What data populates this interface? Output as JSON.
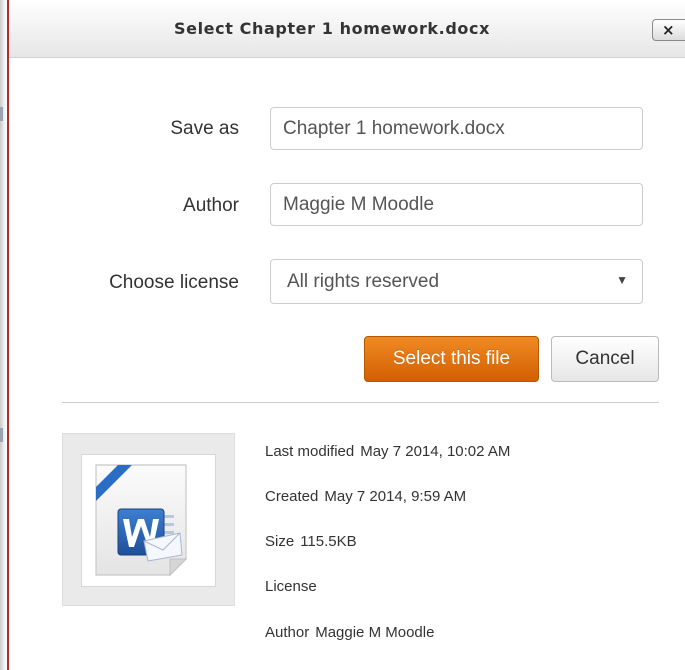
{
  "dialog": {
    "title": "Select Chapter 1 homework.docx",
    "close_glyph": "×"
  },
  "form": {
    "save_as_label": "Save as",
    "save_as_value": "Chapter 1 homework.docx",
    "author_label": "Author",
    "author_value": "Maggie M Moodle",
    "license_label": "Choose license",
    "license_value": "All rights reserved",
    "license_arrow": "▼"
  },
  "actions": {
    "select_label": "Select this file",
    "cancel_label": "Cancel"
  },
  "file_info": {
    "icon": "word-document-icon",
    "last_modified_label": "Last modified",
    "last_modified_value": "May 7 2014, 10:02 AM",
    "created_label": "Created",
    "created_value": "May 7 2014, 9:59 AM",
    "size_label": "Size",
    "size_value": "115.5KB",
    "license_label": "License",
    "license_value": "",
    "author_label": "Author",
    "author_value": "Maggie M Moodle"
  },
  "colors": {
    "primary_button": "#e07410",
    "dialog_border": "#b52a2a",
    "word_blue": "#2b5797"
  }
}
